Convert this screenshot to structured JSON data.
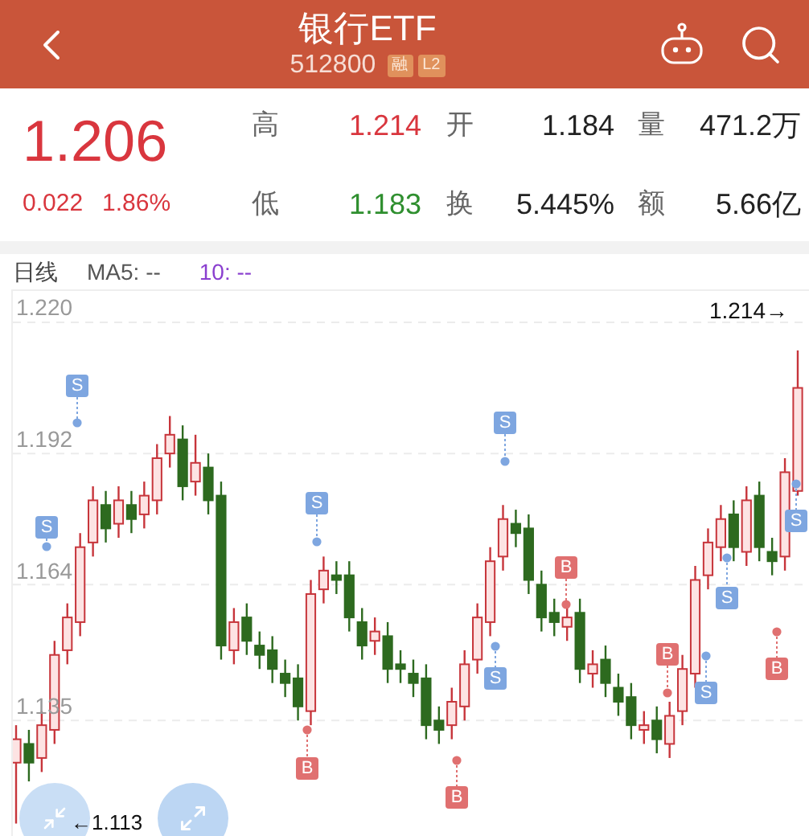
{
  "header": {
    "title": "银行ETF",
    "code": "512800",
    "badges": [
      "融",
      "L2"
    ]
  },
  "quote": {
    "price": "1.206",
    "change": "0.022",
    "change_pct": "1.86%",
    "stats": [
      {
        "label": "高",
        "value": "1.214",
        "color": "#d9363e"
      },
      {
        "label": "开",
        "value": "1.184",
        "color": "#222222"
      },
      {
        "label": "量",
        "value": "471.2万",
        "color": "#222222"
      },
      {
        "label": "低",
        "value": "1.183",
        "color": "#2f8f2f"
      },
      {
        "label": "换",
        "value": "5.445%",
        "color": "#222222"
      },
      {
        "label": "额",
        "value": "5.66亿",
        "color": "#222222"
      }
    ]
  },
  "chart": {
    "period": "日线",
    "ma5": "MA5: --",
    "ma10": "10: --",
    "high_label": "1.214→",
    "low_label": "←1.113",
    "chart_data": {
      "type": "candlestick",
      "grid": true,
      "ylim": [
        1.11,
        1.226
      ],
      "yticks": [
        {
          "value": 1.22,
          "label": "1.220"
        },
        {
          "value": 1.192,
          "label": "1.192"
        },
        {
          "value": 1.164,
          "label": "1.164"
        },
        {
          "value": 1.135,
          "label": "1.135"
        }
      ],
      "ohlc": [
        [
          1.126,
          1.134,
          1.113,
          1.131
        ],
        [
          1.13,
          1.133,
          1.122,
          1.126
        ],
        [
          1.127,
          1.137,
          1.124,
          1.134
        ],
        [
          1.133,
          1.152,
          1.13,
          1.149
        ],
        [
          1.15,
          1.16,
          1.147,
          1.157
        ],
        [
          1.156,
          1.175,
          1.153,
          1.172
        ],
        [
          1.173,
          1.185,
          1.17,
          1.182
        ],
        [
          1.181,
          1.184,
          1.173,
          1.176
        ],
        [
          1.177,
          1.185,
          1.174,
          1.182
        ],
        [
          1.181,
          1.184,
          1.175,
          1.178
        ],
        [
          1.179,
          1.186,
          1.176,
          1.183
        ],
        [
          1.182,
          1.194,
          1.179,
          1.191
        ],
        [
          1.192,
          1.2,
          1.189,
          1.196
        ],
        [
          1.195,
          1.198,
          1.182,
          1.185
        ],
        [
          1.186,
          1.196,
          1.183,
          1.19
        ],
        [
          1.189,
          1.192,
          1.179,
          1.182
        ],
        [
          1.183,
          1.186,
          1.148,
          1.151
        ],
        [
          1.15,
          1.159,
          1.147,
          1.156
        ],
        [
          1.157,
          1.16,
          1.149,
          1.152
        ],
        [
          1.151,
          1.154,
          1.146,
          1.149
        ],
        [
          1.15,
          1.153,
          1.143,
          1.146
        ],
        [
          1.145,
          1.148,
          1.14,
          1.143
        ],
        [
          1.144,
          1.147,
          1.135,
          1.138
        ],
        [
          1.137,
          1.165,
          1.134,
          1.162
        ],
        [
          1.163,
          1.17,
          1.16,
          1.167
        ],
        [
          1.166,
          1.169,
          1.162,
          1.165
        ],
        [
          1.166,
          1.169,
          1.154,
          1.157
        ],
        [
          1.156,
          1.159,
          1.148,
          1.151
        ],
        [
          1.152,
          1.157,
          1.149,
          1.154
        ],
        [
          1.153,
          1.156,
          1.143,
          1.146
        ],
        [
          1.147,
          1.15,
          1.143,
          1.146
        ],
        [
          1.145,
          1.148,
          1.14,
          1.143
        ],
        [
          1.144,
          1.147,
          1.131,
          1.134
        ],
        [
          1.135,
          1.138,
          1.13,
          1.133
        ],
        [
          1.134,
          1.142,
          1.131,
          1.139
        ],
        [
          1.138,
          1.15,
          1.135,
          1.147
        ],
        [
          1.148,
          1.16,
          1.145,
          1.157
        ],
        [
          1.156,
          1.172,
          1.153,
          1.169
        ],
        [
          1.17,
          1.181,
          1.167,
          1.178
        ],
        [
          1.177,
          1.18,
          1.172,
          1.175
        ],
        [
          1.176,
          1.179,
          1.162,
          1.165
        ],
        [
          1.164,
          1.167,
          1.154,
          1.157
        ],
        [
          1.158,
          1.161,
          1.153,
          1.156
        ],
        [
          1.155,
          1.16,
          1.152,
          1.157
        ],
        [
          1.158,
          1.161,
          1.143,
          1.146
        ],
        [
          1.145,
          1.15,
          1.142,
          1.147
        ],
        [
          1.148,
          1.151,
          1.14,
          1.143
        ],
        [
          1.142,
          1.145,
          1.136,
          1.139
        ],
        [
          1.14,
          1.143,
          1.131,
          1.134
        ],
        [
          1.133,
          1.137,
          1.13,
          1.134
        ],
        [
          1.135,
          1.138,
          1.128,
          1.131
        ],
        [
          1.13,
          1.139,
          1.127,
          1.136
        ],
        [
          1.137,
          1.149,
          1.134,
          1.146
        ],
        [
          1.145,
          1.168,
          1.142,
          1.165
        ],
        [
          1.166,
          1.176,
          1.163,
          1.173
        ],
        [
          1.172,
          1.181,
          1.169,
          1.178
        ],
        [
          1.179,
          1.182,
          1.169,
          1.172
        ],
        [
          1.171,
          1.185,
          1.168,
          1.182
        ],
        [
          1.183,
          1.186,
          1.169,
          1.172
        ],
        [
          1.171,
          1.174,
          1.166,
          1.169
        ],
        [
          1.17,
          1.191,
          1.167,
          1.188
        ],
        [
          1.184,
          1.214,
          1.183,
          1.206
        ]
      ]
    },
    "markers": [
      {
        "label": "S",
        "kind": "sell"
      },
      {
        "label": "S",
        "kind": "sell"
      },
      {
        "label": "S",
        "kind": "sell"
      },
      {
        "label": "S",
        "kind": "sell"
      },
      {
        "label": "S",
        "kind": "sell"
      },
      {
        "label": "S",
        "kind": "sell"
      },
      {
        "label": "S",
        "kind": "sell"
      },
      {
        "label": "S",
        "kind": "sell"
      },
      {
        "label": "B",
        "kind": "buy"
      },
      {
        "label": "B",
        "kind": "buy"
      },
      {
        "label": "B",
        "kind": "buy"
      },
      {
        "label": "B",
        "kind": "buy"
      },
      {
        "label": "B",
        "kind": "buy"
      }
    ]
  }
}
